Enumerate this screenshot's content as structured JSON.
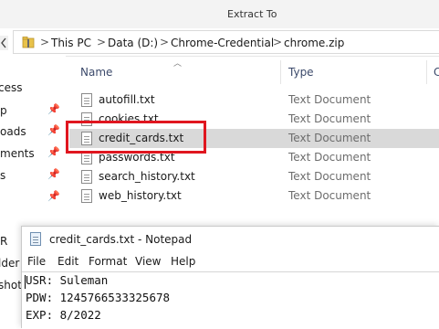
{
  "window": {
    "extract_tab": "Extract To"
  },
  "address_bar": {
    "crumbs": [
      "This PC",
      "Data (D:)",
      "Chrome-Credential",
      "chrome.zip"
    ],
    "separator": ">"
  },
  "nav": {
    "items": [
      {
        "label": "cess"
      },
      {
        "label": "p"
      },
      {
        "label": "oads"
      },
      {
        "label": "ments"
      },
      {
        "label": "s"
      },
      {
        "label": "olor-correctio"
      },
      {
        "label": "R"
      },
      {
        "label": "lder"
      },
      {
        "label": "shot"
      }
    ],
    "pin_glyph": "📌"
  },
  "columns": {
    "name": "Name",
    "type": "Type",
    "extra": "C"
  },
  "files": [
    {
      "name": "autofill.txt",
      "type": "Text Document",
      "selected": false
    },
    {
      "name": "cookies.txt",
      "type": "Text Document",
      "selected": false
    },
    {
      "name": "credit_cards.txt",
      "type": "Text Document",
      "selected": true
    },
    {
      "name": "passwords.txt",
      "type": "Text Document",
      "selected": false
    },
    {
      "name": "search_history.txt",
      "type": "Text Document",
      "selected": false
    },
    {
      "name": "web_history.txt",
      "type": "Text Document",
      "selected": false
    }
  ],
  "notepad": {
    "title": "credit_cards.txt - Notepad",
    "menu": [
      "File",
      "Edit",
      "Format",
      "View",
      "Help"
    ],
    "lines": [
      "USR: Suleman",
      "PDW: 1245766533325678",
      "EXP: 8/2022"
    ]
  },
  "colors": {
    "highlight": "#e0161f",
    "selected_row": "#d9d9d9"
  }
}
